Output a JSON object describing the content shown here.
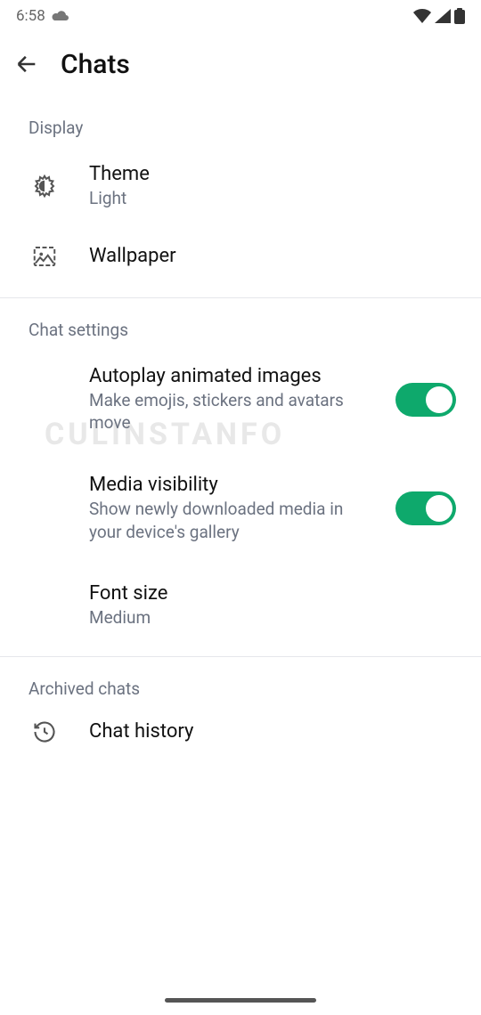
{
  "statusbar": {
    "time": "6:58",
    "cloud_icon": "cloud",
    "wifi_icon": "wifi",
    "signal_icon": "signal",
    "battery_icon": "battery"
  },
  "header": {
    "title": "Chats"
  },
  "sections": {
    "display": {
      "header": "Display",
      "theme": {
        "title": "Theme",
        "value": "Light"
      },
      "wallpaper": {
        "title": "Wallpaper"
      }
    },
    "chat_settings": {
      "header": "Chat settings",
      "autoplay": {
        "title": "Autoplay animated images",
        "subtitle": "Make emojis, stickers and avatars move",
        "enabled": true
      },
      "media_visibility": {
        "title": "Media visibility",
        "subtitle": "Show newly downloaded media in your device's gallery",
        "enabled": true
      },
      "font_size": {
        "title": "Font size",
        "value": "Medium"
      }
    },
    "archived": {
      "header": "Archived chats",
      "chat_history": {
        "title": "Chat history"
      }
    }
  },
  "watermark": "CULINSTANFO"
}
